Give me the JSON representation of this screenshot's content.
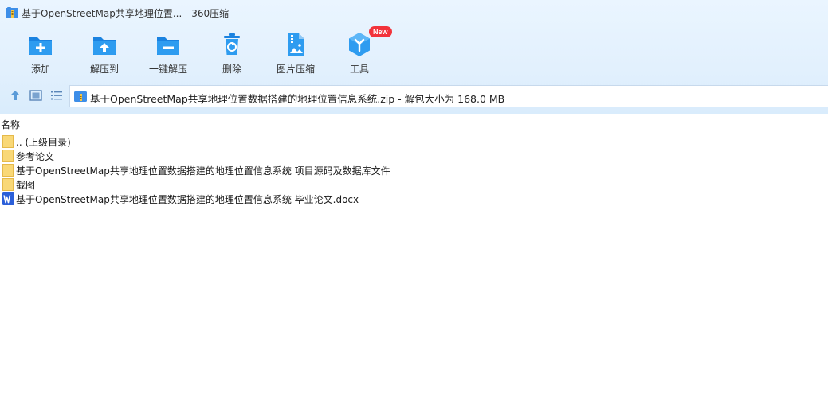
{
  "window": {
    "title": "基于OpenStreetMap共享地理位置... - 360压缩"
  },
  "toolbar": {
    "items": [
      {
        "label": "添加",
        "icon": "add-icon"
      },
      {
        "label": "解压到",
        "icon": "extract-to-icon"
      },
      {
        "label": "一键解压",
        "icon": "one-click-extract-icon"
      },
      {
        "label": "删除",
        "icon": "delete-icon"
      },
      {
        "label": "图片压缩",
        "icon": "image-compress-icon"
      },
      {
        "label": "工具",
        "icon": "tools-icon",
        "badge": "New"
      }
    ]
  },
  "nav": {
    "icons": [
      "up-arrow-icon",
      "view-thumbnail-icon",
      "view-list-icon"
    ]
  },
  "address": {
    "text": "基于OpenStreetMap共享地理位置数据搭建的地理位置信息系统.zip - 解包大小为 168.0 MB"
  },
  "list": {
    "column_name": "名称",
    "items": [
      {
        "name": ".. (上级目录)",
        "type": "folder"
      },
      {
        "name": "参考论文",
        "type": "folder"
      },
      {
        "name": "基于OpenStreetMap共享地理位置数据搭建的地理位置信息系统 项目源码及数据库文件",
        "type": "folder"
      },
      {
        "name": "截图",
        "type": "folder"
      },
      {
        "name": "基于OpenStreetMap共享地理位置数据搭建的地理位置信息系统 毕业论文.docx",
        "type": "word"
      }
    ]
  },
  "colors": {
    "accent": "#1d8fe6",
    "folder": "#f7d26b",
    "word": "#2b5fd9",
    "badge": "#f2333b"
  }
}
